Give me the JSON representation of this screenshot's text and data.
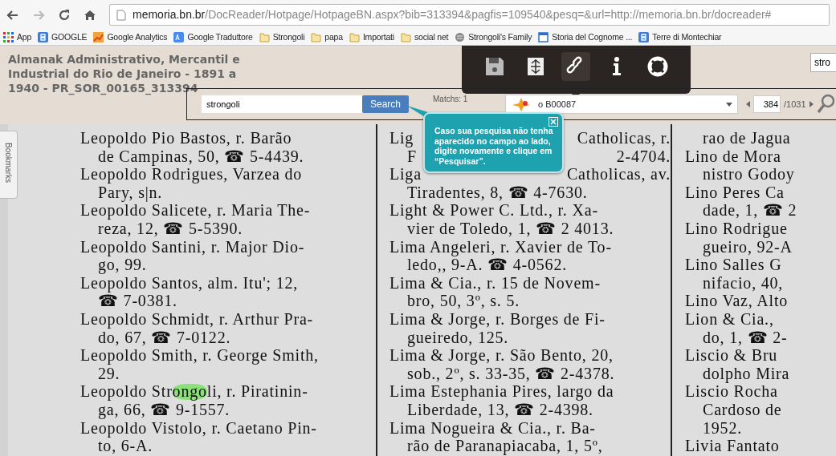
{
  "browser": {
    "url_host": "memoria.bn.br",
    "url_path": "/DocReader/Hotpage/HotpageBN.aspx?bib=313394&pagfis=109540&pesq=&url=http://memoria.bn.br/docreader#",
    "forward_disabled": true
  },
  "bookmarks": [
    {
      "label": "App",
      "kind": "apps"
    },
    {
      "label": "GOOGLE",
      "kind": "google"
    },
    {
      "label": "Google Analytics",
      "kind": "analytics"
    },
    {
      "label": "Google Traduttore",
      "kind": "translate"
    },
    {
      "label": "Strongoli",
      "kind": "folder"
    },
    {
      "label": "papa",
      "kind": "folder"
    },
    {
      "label": "Importati",
      "kind": "folder"
    },
    {
      "label": "social net",
      "kind": "folder"
    },
    {
      "label": "Strongoli's Family",
      "kind": "site"
    },
    {
      "label": "Storia del Cognome ...",
      "kind": "page"
    },
    {
      "label": "Terre di Montechiar",
      "kind": "google"
    }
  ],
  "document_title": [
    "Almanak Administrativo, Mercantil e",
    "Industrial do Rio de Janeiro - 1891 a",
    "1940 - PR_SOR_00165_313394"
  ],
  "toolbar": [
    {
      "kind": "save",
      "selected": false
    },
    {
      "kind": "fit",
      "selected": false
    },
    {
      "kind": "link",
      "selected": true
    },
    {
      "kind": "info",
      "selected": false
    },
    {
      "kind": "help",
      "selected": false
    }
  ],
  "top_search": {
    "value": "stro"
  },
  "search": {
    "value": "strongoli",
    "button": "Search",
    "matches": "Matchs: 1",
    "edition": "o B00087",
    "page": "384",
    "page_total": "/1031"
  },
  "tooltip": {
    "text": "Caso sua pesquisa não tenha aparecido no campo ao lado, digite novamente e clique em “Pesquisar”."
  },
  "side_tab": "Bookmarks",
  "columns": [
    [
      {
        "kind": "entry",
        "lines": [
          {
            "parts": [
              {
                "text": "Leopoldo Pio Bastos, r. Barão",
                "highlighted": false
              }
            ]
          },
          {
            "parts": [
              {
                "text": "de Campinas, 50, ☎ 5-4439.",
                "highlighted": false
              }
            ]
          }
        ]
      },
      {
        "kind": "entry",
        "lines": [
          {
            "parts": [
              {
                "text": "Leopoldo Rodrigues, Varzea do",
                "highlighted": false
              }
            ]
          },
          {
            "parts": [
              {
                "text": "Pary, s|n.",
                "highlighted": false
              }
            ]
          }
        ]
      },
      {
        "kind": "entry",
        "lines": [
          {
            "parts": [
              {
                "text": "Leopoldo Salicete, r. Maria The-",
                "highlighted": false
              }
            ]
          },
          {
            "parts": [
              {
                "text": "reza, 12, ☎ 5-5390.",
                "highlighted": false
              }
            ]
          }
        ]
      },
      {
        "kind": "entry",
        "lines": [
          {
            "parts": [
              {
                "text": "Leopoldo Santini, r. Major Dio-",
                "highlighted": false
              }
            ]
          },
          {
            "parts": [
              {
                "text": "go, 99.",
                "highlighted": false
              }
            ]
          }
        ]
      },
      {
        "kind": "entry",
        "lines": [
          {
            "parts": [
              {
                "text": "Leopoldo Santos, alm. Itu'; 12,",
                "highlighted": false
              }
            ]
          },
          {
            "parts": [
              {
                "text": "☎ 7-0381.",
                "highlighted": false
              }
            ]
          }
        ]
      },
      {
        "kind": "entry",
        "lines": [
          {
            "parts": [
              {
                "text": "Leopoldo Schmidt, r. Arthur Pra-",
                "highlighted": false
              }
            ]
          },
          {
            "parts": [
              {
                "text": "do, 67, ☎ 7-0122.",
                "highlighted": false
              }
            ]
          }
        ]
      },
      {
        "kind": "entry",
        "lines": [
          {
            "parts": [
              {
                "text": "Leopoldo Smith, r. George Smith,",
                "highlighted": false
              }
            ]
          },
          {
            "parts": [
              {
                "text": "29.",
                "highlighted": false
              }
            ]
          }
        ]
      },
      {
        "kind": "entry",
        "lines": [
          {
            "parts": [
              {
                "text": "Leopoldo Str",
                "highlighted": false
              },
              {
                "text": "ongo",
                "highlighted": true
              },
              {
                "text": "li, r. Piratinin-",
                "highlighted": false
              }
            ]
          },
          {
            "parts": [
              {
                "text": "ga, 66, ☎ 9-1557.",
                "highlighted": false
              }
            ]
          }
        ]
      },
      {
        "kind": "entry",
        "lines": [
          {
            "parts": [
              {
                "text": "Leopoldo Vistolo, r. Caetano Pin-",
                "highlighted": false
              }
            ]
          },
          {
            "parts": [
              {
                "text": "to, 6-A.",
                "highlighted": false
              }
            ]
          }
        ]
      }
    ],
    [
      {
        "kind": "entry",
        "lines": [
          {
            "segments": [
              "Lig",
              "Catholicas, r."
            ]
          },
          {
            "segments": [
              "F",
              "2-4704."
            ]
          }
        ]
      },
      {
        "kind": "entry",
        "lines": [
          {
            "segments": [
              "Liga",
              "Catholicas, av."
            ]
          },
          {
            "parts": [
              {
                "text": "Tiradentes, 8, ☎ 4-7630.",
                "highlighted": false
              }
            ]
          }
        ]
      },
      {
        "kind": "entry",
        "lines": [
          {
            "parts": [
              {
                "text": "Light & Power C. Ltd., r. Xa-",
                "highlighted": false
              }
            ]
          },
          {
            "parts": [
              {
                "text": "vier de Toledo, 1, ☎ 2 4013.",
                "highlighted": false
              }
            ]
          }
        ]
      },
      {
        "kind": "entry",
        "lines": [
          {
            "parts": [
              {
                "text": "Lima Angeleri, r. Xavier de To-",
                "highlighted": false
              }
            ]
          },
          {
            "parts": [
              {
                "text": "ledo,, 9-A. ☎ 4-0562.",
                "highlighted": false
              }
            ]
          }
        ]
      },
      {
        "kind": "entry",
        "lines": [
          {
            "parts": [
              {
                "text": "Lima & Cia., r. 15 de Novem-",
                "highlighted": false
              }
            ]
          },
          {
            "parts": [
              {
                "text": "bro, 50, 3º, s. 5.",
                "highlighted": false
              }
            ]
          }
        ]
      },
      {
        "kind": "entry",
        "lines": [
          {
            "parts": [
              {
                "text": "Lima & Jorge, r. Borges de Fi-",
                "highlighted": false
              }
            ]
          },
          {
            "parts": [
              {
                "text": "gueiredo, 125.",
                "highlighted": false
              }
            ]
          }
        ]
      },
      {
        "kind": "entry",
        "lines": [
          {
            "parts": [
              {
                "text": "Lima & Jorge, r. São Bento, 20,",
                "highlighted": false
              }
            ]
          },
          {
            "parts": [
              {
                "text": "sob., 2º, s. 33-35, ☎ 2-4378.",
                "highlighted": false
              }
            ]
          }
        ]
      },
      {
        "kind": "entry",
        "lines": [
          {
            "parts": [
              {
                "text": "Lima Estephania Pires, largo da",
                "highlighted": false
              }
            ]
          },
          {
            "parts": [
              {
                "text": "Liberdade, 13, ☎ 2-4398.",
                "highlighted": false
              }
            ]
          }
        ]
      },
      {
        "kind": "entry",
        "lines": [
          {
            "parts": [
              {
                "text": "Lima Nogueira & Cia., r. Ba-",
                "highlighted": false
              }
            ]
          },
          {
            "parts": [
              {
                "text": "rão de Paranapiacaba, 1, 5º,",
                "highlighted": false
              }
            ]
          }
        ]
      }
    ],
    [
      {
        "kind": "tail",
        "lines": [
          {
            "parts": [
              {
                "text": "rao de Jagua",
                "highlighted": false
              }
            ]
          }
        ]
      },
      {
        "kind": "entry",
        "lines": [
          {
            "parts": [
              {
                "text": "Lino de Mora",
                "highlighted": false
              }
            ]
          },
          {
            "parts": [
              {
                "text": "nistro Godoy",
                "highlighted": false
              }
            ]
          }
        ]
      },
      {
        "kind": "entry",
        "lines": [
          {
            "parts": [
              {
                "text": "Lino Peres Ca",
                "highlighted": false
              }
            ]
          },
          {
            "parts": [
              {
                "text": "dade, 1, ☎ 2",
                "highlighted": false
              }
            ]
          }
        ]
      },
      {
        "kind": "entry",
        "lines": [
          {
            "parts": [
              {
                "text": "Lino Rodrigue",
                "highlighted": false
              }
            ]
          },
          {
            "parts": [
              {
                "text": "gueiro, 92-A",
                "highlighted": false
              }
            ]
          }
        ]
      },
      {
        "kind": "entry",
        "lines": [
          {
            "parts": [
              {
                "text": "Lino Salles G",
                "highlighted": false
              }
            ]
          },
          {
            "parts": [
              {
                "text": "nifacio, 40,",
                "highlighted": false
              }
            ]
          }
        ]
      },
      {
        "kind": "entry",
        "lines": [
          {
            "parts": [
              {
                "text": "Lino Vaz, Alto",
                "highlighted": false
              }
            ]
          }
        ]
      },
      {
        "kind": "entry",
        "lines": [
          {
            "parts": [
              {
                "text": "Lion & Cia.,",
                "highlighted": false
              }
            ]
          },
          {
            "parts": [
              {
                "text": "do, 1, ☎ 2-",
                "highlighted": false
              }
            ]
          }
        ]
      },
      {
        "kind": "entry",
        "lines": [
          {
            "parts": [
              {
                "text": "Liscio & Bru",
                "highlighted": false
              }
            ]
          },
          {
            "parts": [
              {
                "text": "dolpho Mira",
                "highlighted": false
              }
            ]
          }
        ]
      },
      {
        "kind": "entry",
        "lines": [
          {
            "parts": [
              {
                "text": "Liscio Rocha",
                "highlighted": false
              }
            ]
          },
          {
            "parts": [
              {
                "text": "Cardoso de",
                "highlighted": false
              }
            ]
          },
          {
            "parts": [
              {
                "text": "1952.",
                "highlighted": false
              }
            ]
          }
        ]
      },
      {
        "kind": "entry",
        "lines": [
          {
            "parts": [
              {
                "text": "Livia Fantato",
                "highlighted": false
              }
            ]
          }
        ]
      }
    ]
  ]
}
